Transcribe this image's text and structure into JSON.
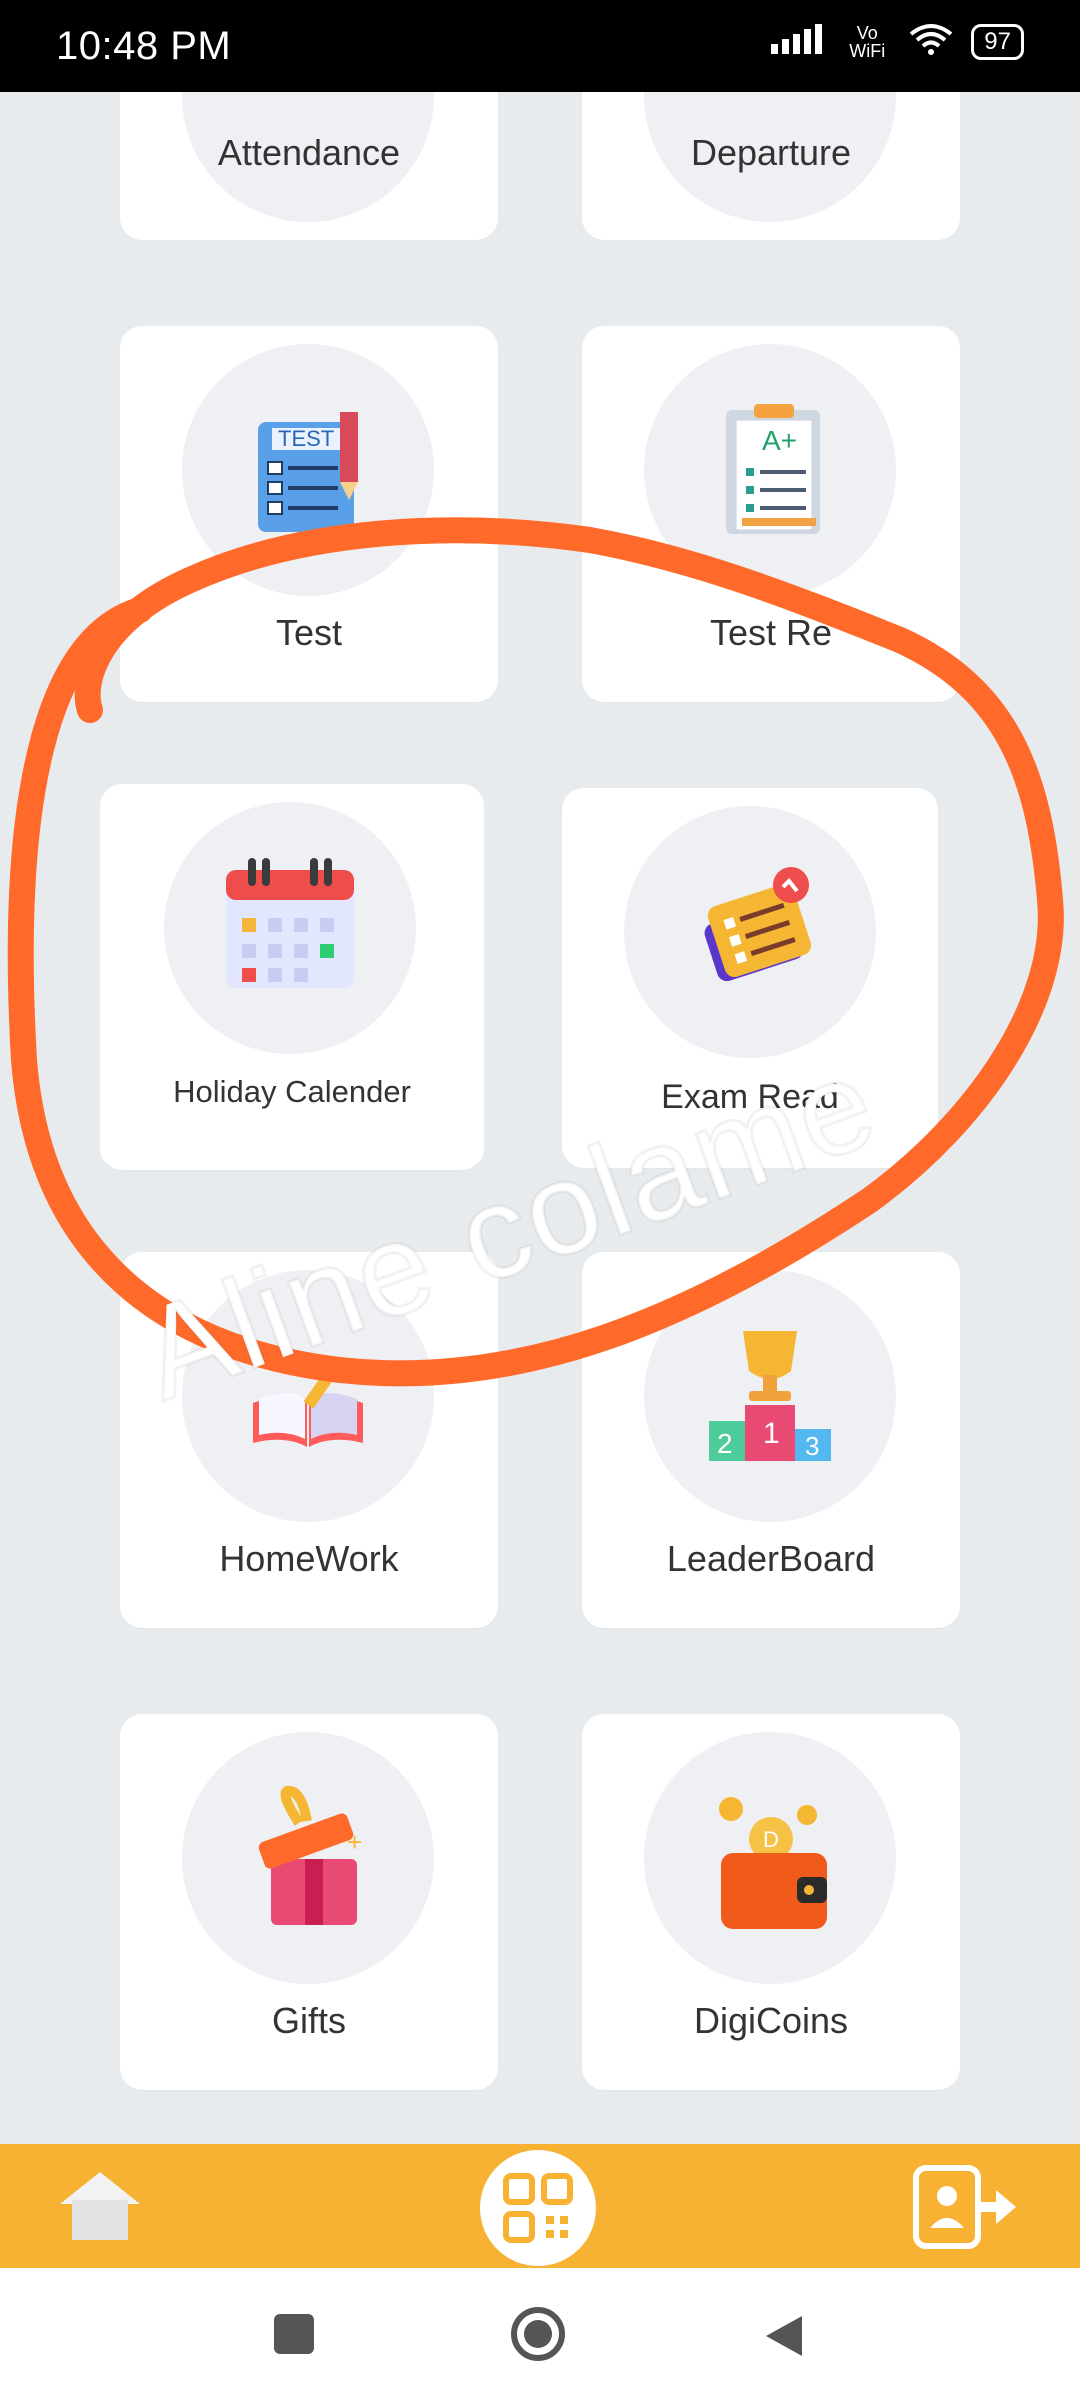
{
  "status": {
    "time": "10:48 PM",
    "battery": "97",
    "network_label": "Vo WiFi"
  },
  "tiles": {
    "attendance": "Attendance",
    "departure": "Departure",
    "test": "Test",
    "test_result_partial": "Test Re",
    "holiday": "Holiday Calender",
    "exam": "Exam Read",
    "homework": "HomeWork",
    "leaderboard": "LeaderBoard",
    "gifts": "Gifts",
    "digicoins": "DigiCoins"
  },
  "overlay_text": "Aline colame",
  "icons": {
    "home": "home-icon",
    "qr": "qr-code-icon",
    "logout": "logout-icon",
    "recents": "recents-square-icon",
    "home_sys": "home-circle-icon",
    "back": "back-triangle-icon"
  },
  "colors": {
    "accent": "#f7b133",
    "annotation": "#ff6a2a"
  }
}
